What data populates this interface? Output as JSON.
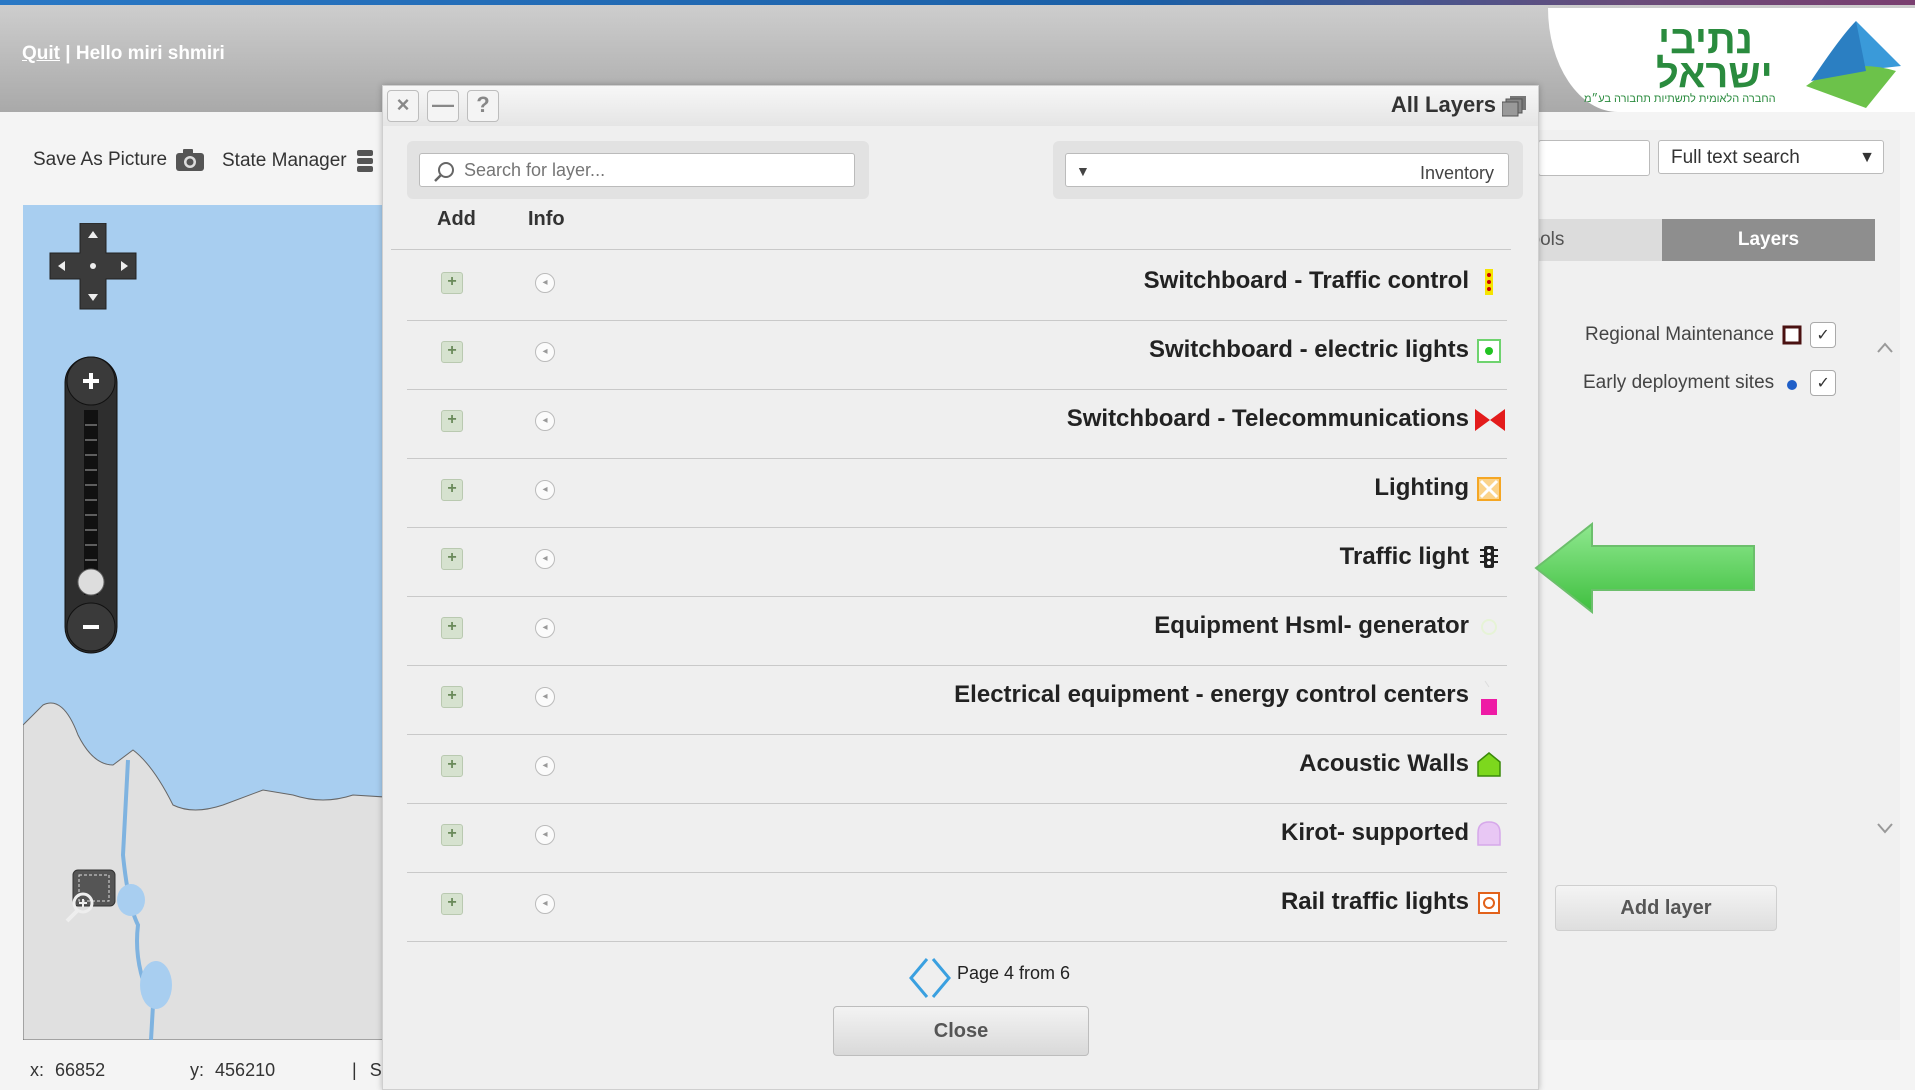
{
  "header": {
    "quit_label": "Quit",
    "separator": "|",
    "greeting": "Hello miri shmiri",
    "logo_line1": "נתיבי",
    "logo_line2": "ישראל",
    "logo_tagline": "החברה הלאומית לתשתיות תחבורה בע״מ"
  },
  "toolbar": {
    "save_picture_label": "Save As Picture",
    "state_manager_label": "State Manager"
  },
  "status": {
    "x_label": "x:",
    "x_value": "66852",
    "y_label": "y:",
    "y_value": "456210",
    "sep": "|",
    "trailing": "S"
  },
  "right_panel": {
    "search_select": "Full text search",
    "tab_tools": "Tools",
    "tab_layers": "Layers",
    "layers": [
      {
        "label": "Regional Maintenance",
        "checked": "✓"
      },
      {
        "label": "Early deployment sites",
        "checked": "✓"
      }
    ],
    "add_layer_label": "Add layer"
  },
  "dialog": {
    "title": "All Layers",
    "close_glyph": "×",
    "minimize_glyph": "—",
    "help_glyph": "?",
    "search_placeholder": "Search for layer...",
    "category_value": "Inventory",
    "col_add": "Add",
    "col_info": "Info",
    "rows": [
      {
        "name": "Switchboard - Traffic control",
        "icon": "traffic-control-icon"
      },
      {
        "name": "Switchboard - electric lights",
        "icon": "electric-lights-icon"
      },
      {
        "name": "Switchboard - Telecommunications",
        "icon": "telecom-icon"
      },
      {
        "name": "Lighting",
        "icon": "lighting-icon"
      },
      {
        "name": "Traffic light",
        "icon": "traffic-light-icon"
      },
      {
        "name": "Equipment Hsml- generator",
        "icon": "generator-icon"
      },
      {
        "name": "Electrical equipment - energy control centers",
        "icon": "energy-center-icon"
      },
      {
        "name": "Acoustic Walls",
        "icon": "acoustic-wall-icon"
      },
      {
        "name": "Kirot- supported",
        "icon": "kirot-icon"
      },
      {
        "name": "Rail traffic lights",
        "icon": "rail-light-icon"
      }
    ],
    "page_label": "Page 4 from 6",
    "close_label": "Close"
  },
  "colors": {
    "accent_green": "#6bd26b",
    "topbar_gray": "#b3b3b3",
    "map_water": "#a8cef0"
  }
}
